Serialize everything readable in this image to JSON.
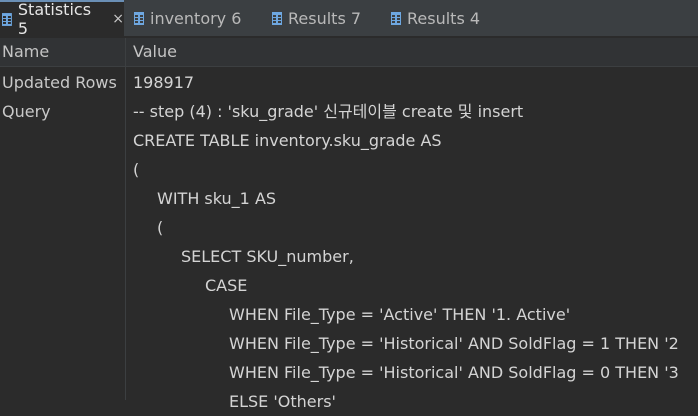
{
  "tabs": [
    {
      "label": "Statistics 5",
      "active": true,
      "closable": true,
      "icon": "grid-icon"
    },
    {
      "label": "inventory 6",
      "active": false,
      "icon": "grid-icon"
    },
    {
      "label": "Results 7",
      "active": false,
      "icon": "grid-icon"
    },
    {
      "label": "Results 4",
      "active": false,
      "icon": "grid-icon"
    }
  ],
  "close_glyph": "×",
  "columns": {
    "name": "Name",
    "value": "Value"
  },
  "rows": {
    "updated_rows": {
      "name": "Updated Rows",
      "value": "198917"
    },
    "query": {
      "name": "Query",
      "lines": [
        "-- step (4) : 'sku_grade' 신규테이블 create 및 insert",
        "CREATE TABLE inventory.sku_grade AS",
        "(",
        "WITH sku_1 AS",
        "(",
        "SELECT SKU_number,",
        "CASE",
        "WHEN File_Type = 'Active' THEN '1. Active'",
        "WHEN File_Type = 'Historical' AND SoldFlag = 1 THEN '2",
        "WHEN File_Type = 'Historical' AND SoldFlag = 0 THEN '3",
        "ELSE 'Others'"
      ]
    }
  },
  "colors": {
    "background": "#2b2b2b",
    "tabbar": "#3b3f42",
    "active_tab_accent": "#6a8fb5",
    "icon_blue": "#6ea7e0"
  }
}
